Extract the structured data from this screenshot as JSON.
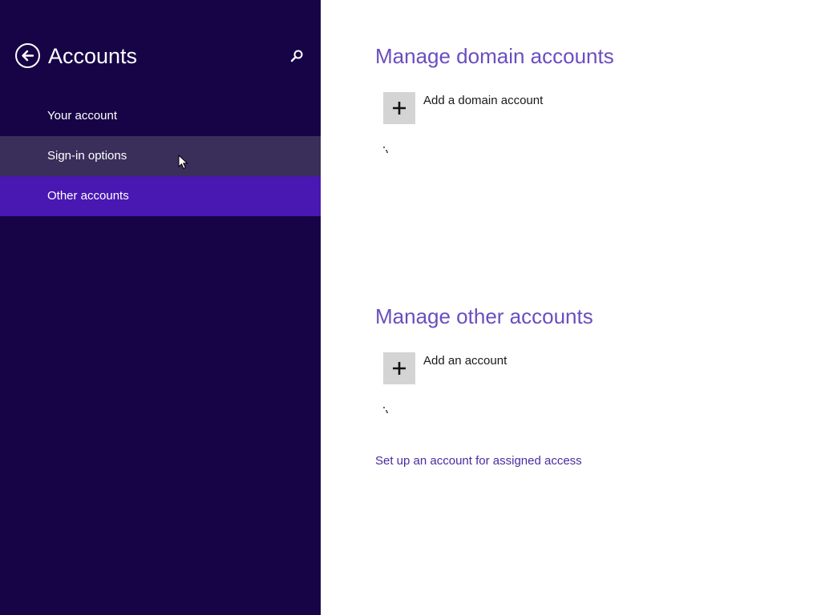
{
  "sidebar": {
    "title": "Accounts",
    "back_icon": "back-arrow-icon",
    "search_icon": "search-icon",
    "items": [
      {
        "label": "Your account",
        "state": "normal"
      },
      {
        "label": "Sign-in options",
        "state": "hover"
      },
      {
        "label": "Other accounts",
        "state": "selected"
      }
    ]
  },
  "main": {
    "domain_section": {
      "heading": "Manage domain accounts",
      "add_label": "Add a domain account",
      "add_icon": "plus-icon"
    },
    "other_section": {
      "heading": "Manage other accounts",
      "add_label": "Add an account",
      "add_icon": "plus-icon"
    },
    "assigned_access_link": "Set up an account for assigned access"
  },
  "colors": {
    "sidebar_bg": "#170446",
    "sidebar_hover": "#392f5a",
    "sidebar_selected": "#4917b2",
    "heading": "#6a4ec0",
    "link": "#4b2ba0",
    "tile_bg": "#d4d4d4"
  }
}
